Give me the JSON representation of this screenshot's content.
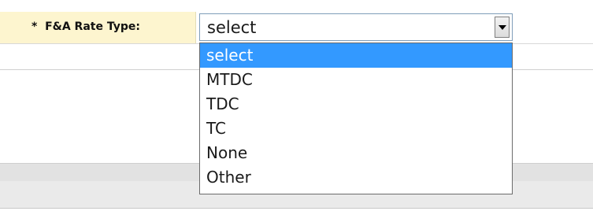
{
  "field": {
    "required_marker": "*",
    "label": "F&A Rate Type:"
  },
  "select": {
    "value": "select",
    "options": [
      "select",
      "MTDC",
      "TDC",
      "TC",
      "None",
      "Other"
    ],
    "highlighted_index": 0
  },
  "colors": {
    "label_background": "#fdf5cf",
    "highlight": "#3399ff"
  }
}
